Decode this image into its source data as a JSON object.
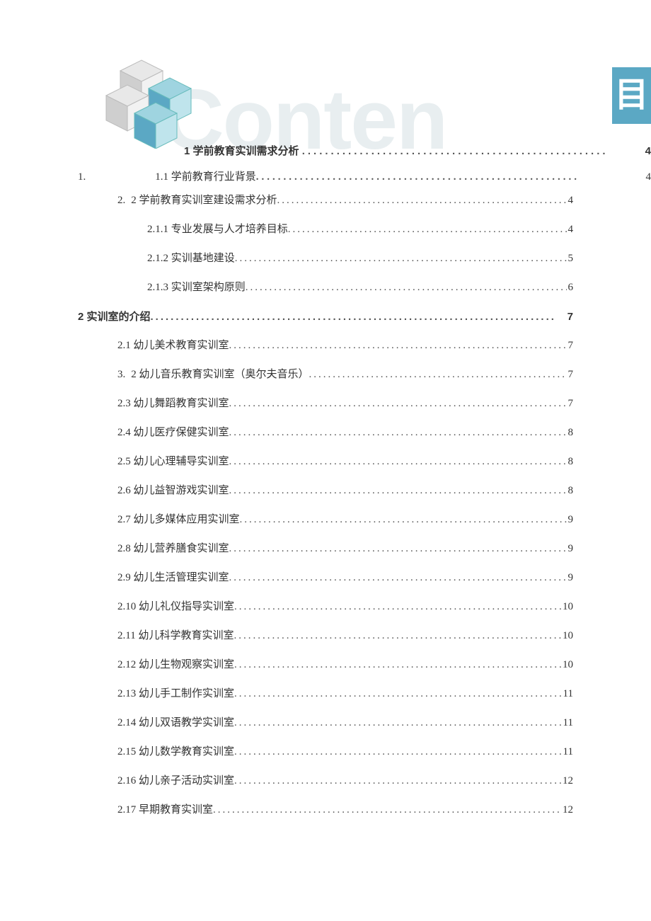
{
  "header": {
    "watermark_text": "Conten",
    "side_badge": "目"
  },
  "toc": {
    "line1": {
      "title": "1 学前教育实训需求分析",
      "page": "4"
    },
    "line2": {
      "prefix": "1.",
      "title": "1.1 学前教育行业背景",
      "page": "4"
    },
    "entries": [
      {
        "level": 1,
        "prefix": "2. ",
        "title": "2 学前教育实训室建设需求分析",
        "page": "4"
      },
      {
        "level": 2,
        "prefix": "",
        "title": "2.1.1  专业发展与人才培养目标",
        "page": "4"
      },
      {
        "level": 2,
        "prefix": "",
        "title": "2.1.2  实训基地建设",
        "page": "5"
      },
      {
        "level": 2,
        "prefix": "",
        "title": "2.1.3  实训室架构原则",
        "page": "6"
      },
      {
        "level": 0,
        "prefix": "",
        "title": "2 实训室的介绍",
        "page": "7"
      },
      {
        "level": 1,
        "prefix": "",
        "title": "2.1 幼儿美术教育实训室",
        "page": "7"
      },
      {
        "level": 1,
        "prefix": "3. ",
        "title": "2 幼儿音乐教育实训室（奥尔夫音乐）",
        "page": "7"
      },
      {
        "level": 1,
        "prefix": "",
        "title": "2.3 幼儿舞蹈教育实训室",
        "page": "7"
      },
      {
        "level": 1,
        "prefix": "",
        "title": "2.4 幼儿医疗保健实训室",
        "page": "8"
      },
      {
        "level": 1,
        "prefix": "",
        "title": "2.5 幼儿心理辅导实训室",
        "page": "8"
      },
      {
        "level": 1,
        "prefix": "",
        "title": "2.6 幼儿益智游戏实训室",
        "page": "8"
      },
      {
        "level": 1,
        "prefix": "",
        "title": "2.7 幼儿多媒体应用实训室",
        "page": "9"
      },
      {
        "level": 1,
        "prefix": "",
        "title": "2.8 幼儿营养膳食实训室",
        "page": "9"
      },
      {
        "level": 1,
        "prefix": "",
        "title": "2.9 幼儿生活管理实训室",
        "page": "9"
      },
      {
        "level": 1,
        "prefix": "",
        "title": "2.10 幼儿礼仪指导实训室",
        "page": "10"
      },
      {
        "level": 1,
        "prefix": "",
        "title": "2.11 幼儿科学教育实训室",
        "page": "10"
      },
      {
        "level": 1,
        "prefix": "",
        "title": "2.12 幼儿生物观察实训室",
        "page": "10"
      },
      {
        "level": 1,
        "prefix": "",
        "title": "2.13 幼儿手工制作实训室",
        "page": "11"
      },
      {
        "level": 1,
        "prefix": "",
        "title": "2.14 幼儿双语教学实训室",
        "page": "11"
      },
      {
        "level": 1,
        "prefix": "",
        "title": "2.15 幼儿数学教育实训室",
        "page": "11"
      },
      {
        "level": 1,
        "prefix": "",
        "title": "2.16 幼儿亲子活动实训室",
        "page": "12"
      },
      {
        "level": 1,
        "prefix": "",
        "title": "2.17 早期教育实训室",
        "page": "12"
      }
    ]
  }
}
